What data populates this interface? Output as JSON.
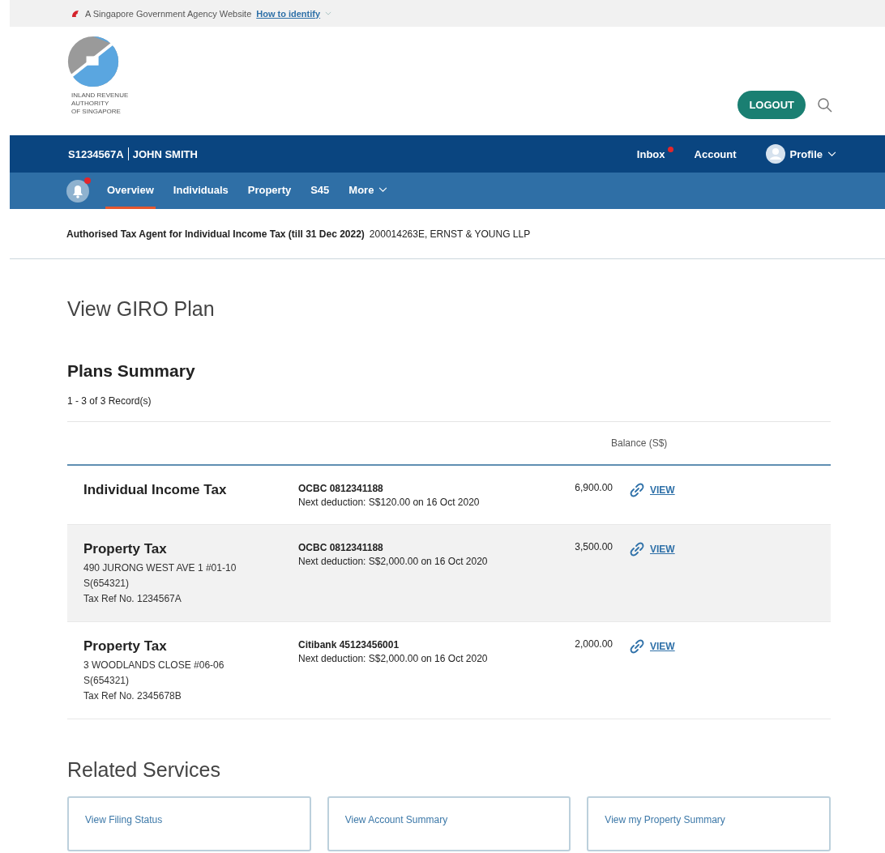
{
  "gov_banner": {
    "text": "A Singapore Government Agency Website",
    "link": "How to identify"
  },
  "logo": {
    "lines": [
      "INLAND REVENUE",
      "AUTHORITY",
      "OF SINGAPORE"
    ]
  },
  "header": {
    "logout": "LOGOUT"
  },
  "user_bar": {
    "id": "S1234567A",
    "name": "JOHN SMITH",
    "inbox": {
      "label": "Inbox",
      "unread": true
    },
    "account": "Account",
    "profile": "Profile"
  },
  "nav": {
    "bell_unread": true,
    "tabs": [
      {
        "label": "Overview",
        "selected": true
      },
      {
        "label": "Individuals",
        "selected": false
      },
      {
        "label": "Property",
        "selected": false
      },
      {
        "label": "S45",
        "selected": false
      },
      {
        "label": "More",
        "selected": false,
        "dropdown": true
      }
    ]
  },
  "agent": {
    "label": "Authorised Tax Agent for Individual Income Tax (till 31 Dec 2022)",
    "value": "200014263E, ERNST & YOUNG LLP"
  },
  "page_title": "View GIRO Plan",
  "section_title": "Plans Summary",
  "records": "1 - 3 of 3 Record(s)",
  "table": {
    "columns": [
      "Balance (S$)"
    ],
    "rows": [
      {
        "title": "Individual Income Tax",
        "details": [],
        "bank": "OCBC 0812341188",
        "next": "Next deduction: S$120.00 on 16 Oct 2020",
        "balance": "6,900.00",
        "action": "VIEW"
      },
      {
        "title": "Property Tax",
        "details": [
          "490 JURONG WEST AVE 1 #01-10",
          "S(654321)",
          "Tax Ref No. 1234567A"
        ],
        "bank": "OCBC 0812341188",
        "next": "Next deduction: S$2,000.00 on 16 Oct 2020",
        "balance": "3,500.00",
        "action": "VIEW"
      },
      {
        "title": "Property Tax",
        "details": [
          "3 WOODLANDS CLOSE #06-06",
          "S(654321)",
          "Tax Ref No. 2345678B"
        ],
        "bank": "Citibank 45123456001",
        "next": "Next deduction: S$2,000.00 on 16 Oct 2020",
        "balance": "2,000.00",
        "action": "VIEW"
      }
    ]
  },
  "related": {
    "title": "Related Services",
    "cards": [
      "View Filing Status",
      "View Account Summary",
      "View my Property Summary"
    ]
  }
}
